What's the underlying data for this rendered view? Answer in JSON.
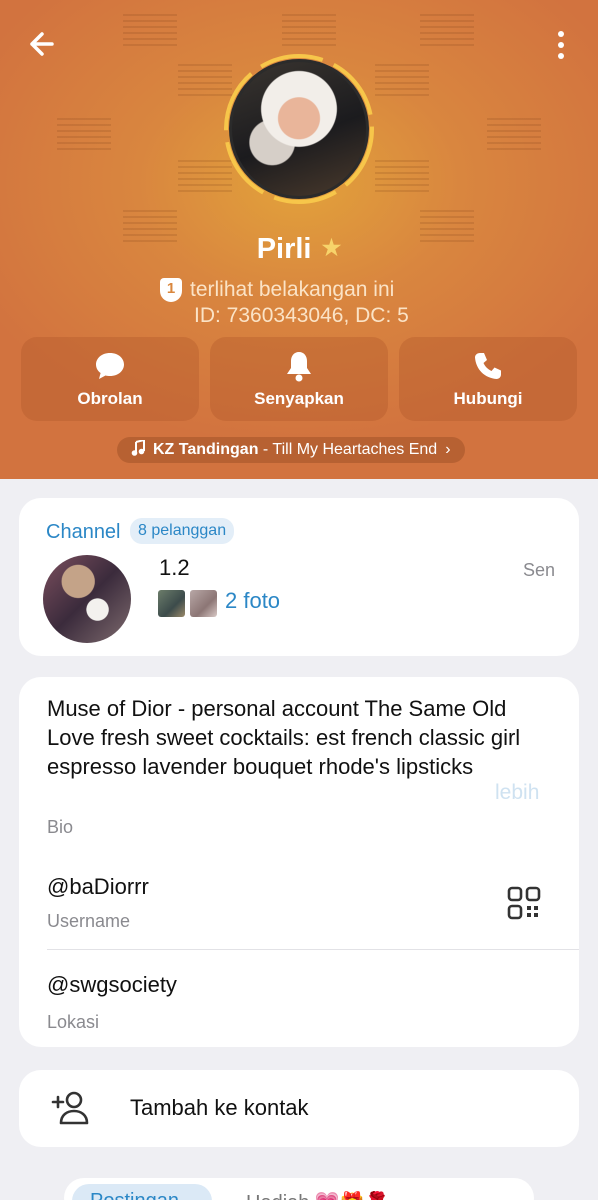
{
  "header": {
    "name": "Pirli",
    "verified_star": "★",
    "status_badge": "1",
    "status": "terlihat belakangan ini",
    "id_line": "ID: 7360343046, DC: 5",
    "colors": {
      "top": "#e2a23b",
      "bottom": "#d2733f"
    }
  },
  "actions": [
    {
      "label": "Obrolan",
      "icon": "chat-bubble-icon"
    },
    {
      "label": "Senyapkan",
      "icon": "bell-icon"
    },
    {
      "label": "Hubungi",
      "icon": "phone-icon"
    }
  ],
  "music": {
    "artist": "KZ Tandingan",
    "title": " - Till My Heartaches End",
    "chevron": "›"
  },
  "channel": {
    "label": "Channel",
    "subscribers": "8 pelanggan",
    "title": "1.2",
    "time": "Sen",
    "photos": "2 foto"
  },
  "info": {
    "bio": "Muse of Dior - personal account The Same Old Love fresh sweet cocktails: est french classic girl espresso lavender bouquet rhode's lipsticks",
    "more": "lebih",
    "bio_label": "Bio",
    "username": "@baDiorrr",
    "username_label": "Username",
    "location": "@swgsociety",
    "location_label": "Lokasi"
  },
  "add_contact": {
    "label": "Tambah ke kontak"
  },
  "tabs": {
    "active": "Postingan",
    "other": "Hadiah 💗🎁🌹"
  }
}
